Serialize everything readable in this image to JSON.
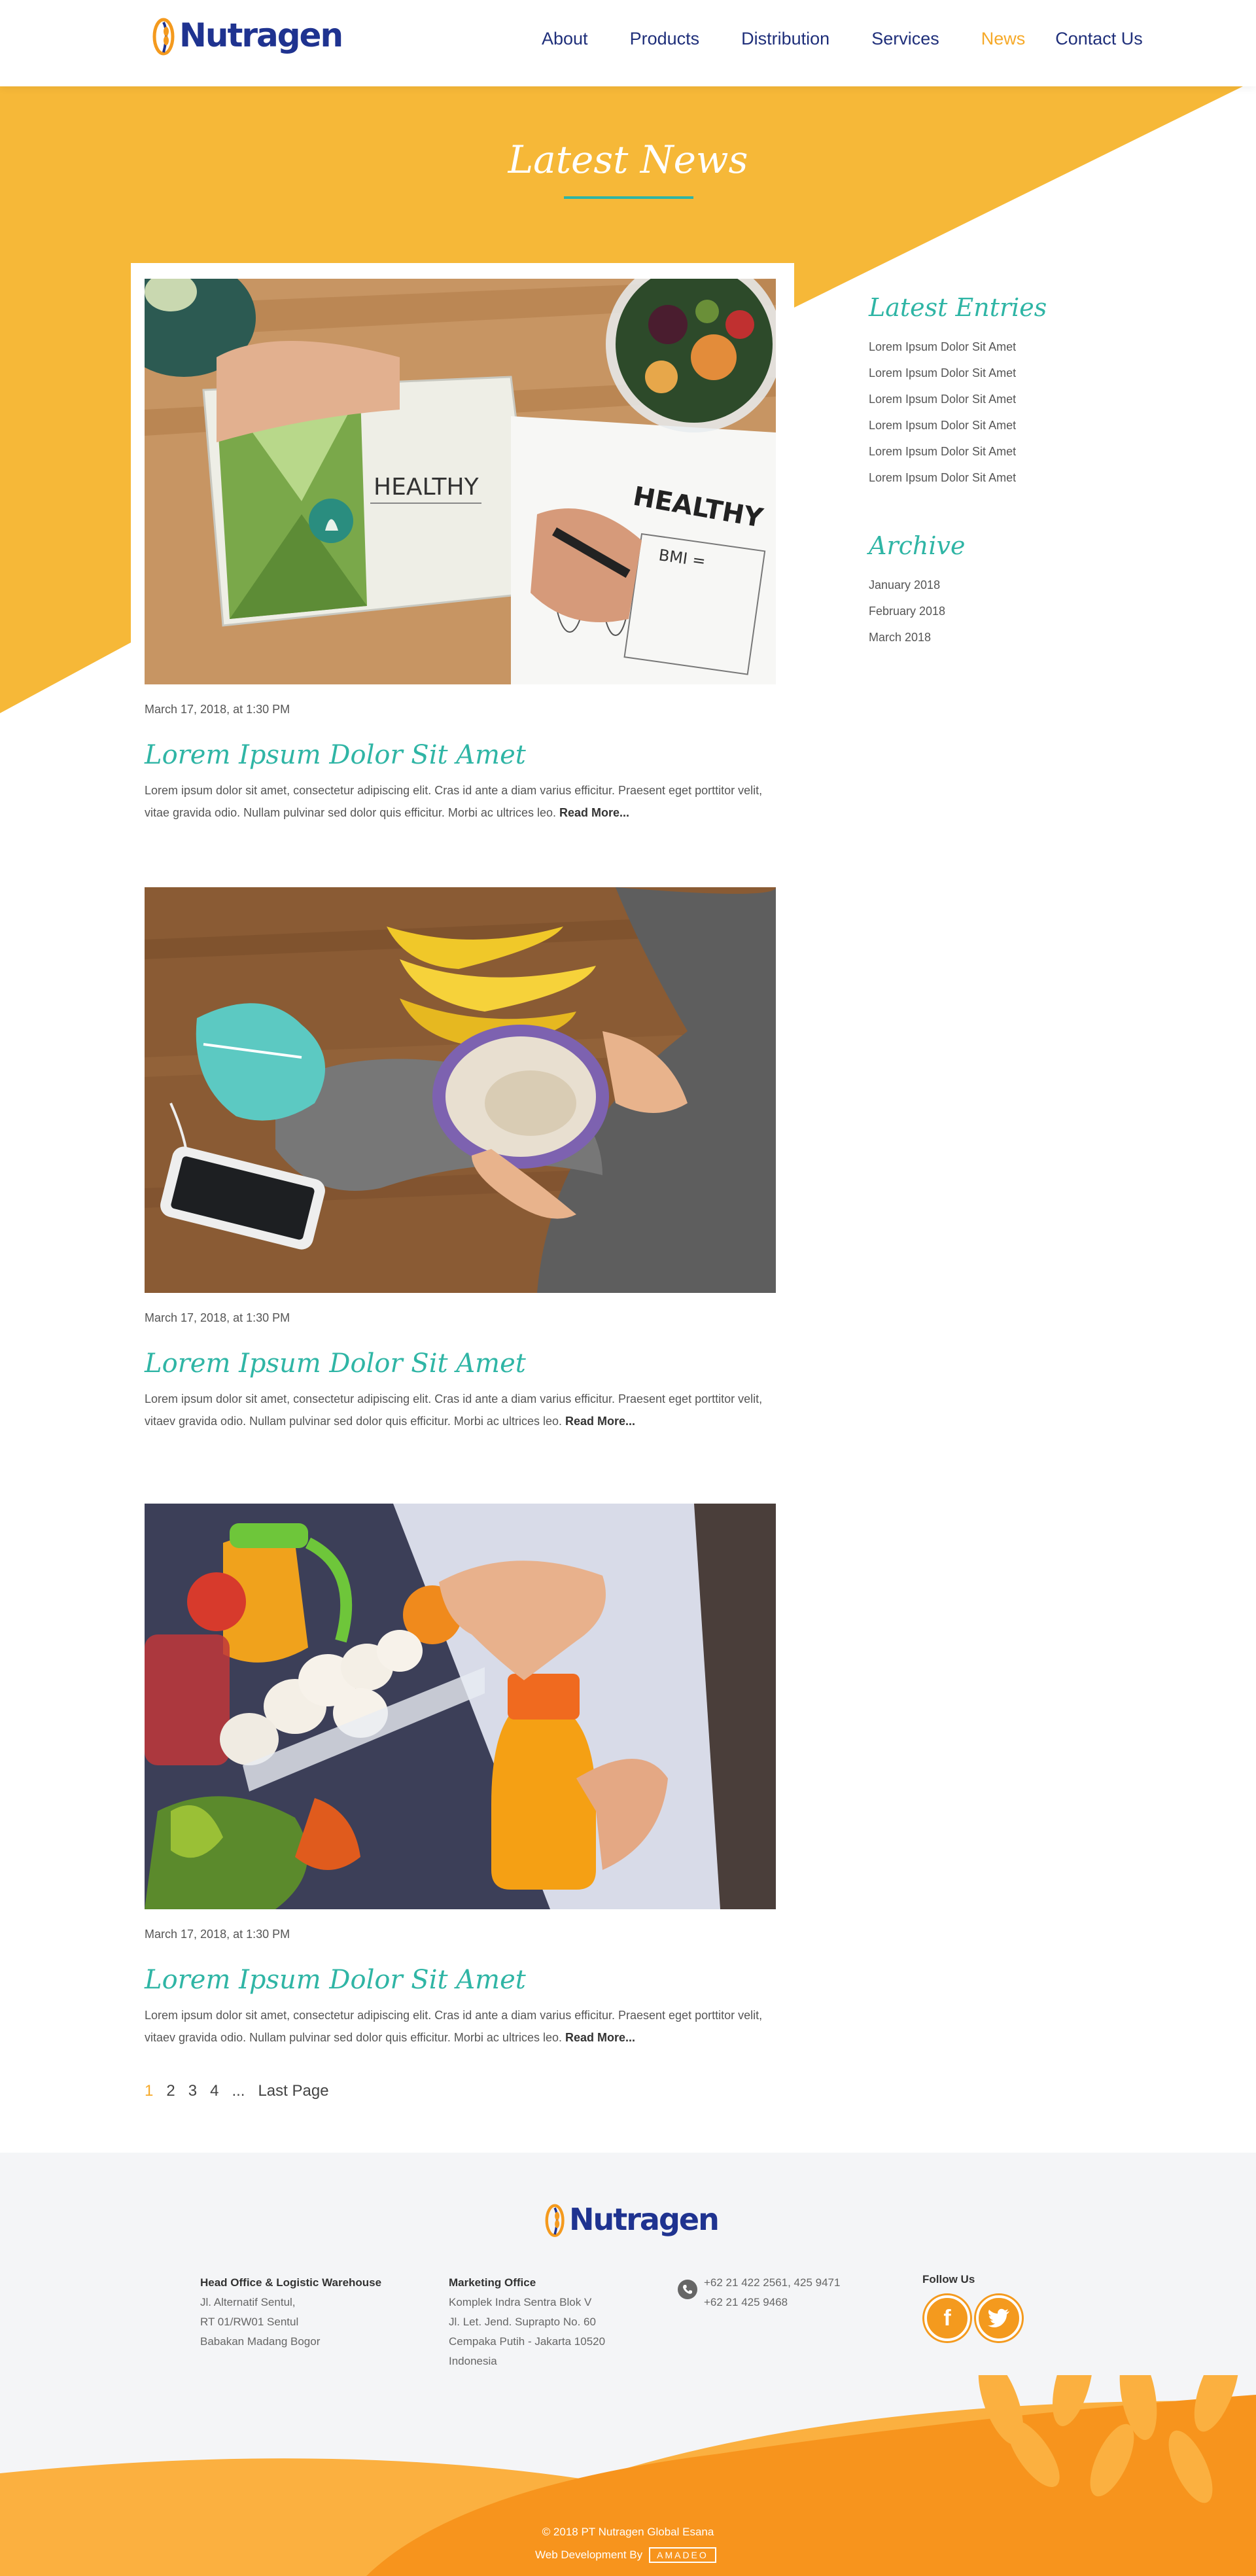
{
  "brand": {
    "name": "Nutragen"
  },
  "nav": [
    {
      "label": "About",
      "active": false
    },
    {
      "label": "Products",
      "active": false
    },
    {
      "label": "Distribution",
      "active": false
    },
    {
      "label": "Services",
      "active": false
    },
    {
      "label": "News",
      "active": true
    },
    {
      "label": "Contact Us",
      "active": false
    }
  ],
  "page": {
    "title": "Latest News"
  },
  "articles": [
    {
      "date": "March 17, 2018, at 1:30 PM",
      "title": "Lorem Ipsum Dolor Sit Amet",
      "excerpt": "Lorem ipsum dolor sit amet, consectetur adipiscing elit. Cras id ante a diam varius efficitur. Praesent eget porttitor velit, vitae gravida odio. Nullam pulvinar sed dolor quis efficitur. Morbi ac ultrices leo.",
      "read_more": "Read More...",
      "image": "healthy-notebook-photo",
      "image_text": "HEALTHY"
    },
    {
      "date": "March 17, 2018, at 1:30 PM",
      "title": "Lorem Ipsum Dolor Sit Amet",
      "excerpt": "Lorem ipsum dolor sit amet, consectetur adipiscing elit. Cras id ante a diam varius efficitur. Praesent eget porttitor velit, vitaev gravida odio. Nullam pulvinar sed dolor quis efficitur. Morbi ac ultrices leo.",
      "read_more": "Read More...",
      "image": "bananas-oatmeal-photo"
    },
    {
      "date": "March 17, 2018, at 1:30 PM",
      "title": "Lorem Ipsum Dolor Sit Amet",
      "excerpt": "Lorem ipsum dolor sit amet, consectetur adipiscing elit. Cras id ante a diam varius efficitur. Praesent eget porttitor velit, vitaev gravida odio. Nullam pulvinar sed dolor quis efficitur. Morbi ac ultrices leo.",
      "read_more": "Read More...",
      "image": "fridge-juice-photo"
    }
  ],
  "sidebar": {
    "latest_title": "Latest Entries",
    "latest": [
      "Lorem Ipsum Dolor Sit Amet",
      "Lorem Ipsum Dolor Sit Amet",
      "Lorem Ipsum Dolor Sit Amet",
      "Lorem Ipsum Dolor Sit Amet",
      "Lorem Ipsum Dolor Sit Amet",
      "Lorem Ipsum Dolor Sit Amet"
    ],
    "archive_title": "Archive",
    "archive": [
      "January 2018",
      "February 2018",
      "March 2018"
    ]
  },
  "pagination": {
    "pages": [
      "1",
      "2",
      "3",
      "4"
    ],
    "current": "1",
    "ellipsis": "...",
    "last": "Last Page"
  },
  "footer": {
    "head_office": {
      "title": "Head Office & Logistic Warehouse",
      "lines": [
        "Jl. Alternatif Sentul,",
        "RT 01/RW01 Sentul",
        "Babakan Madang Bogor"
      ]
    },
    "marketing_office": {
      "title": "Marketing Office",
      "lines": [
        "Komplek Indra Sentra Blok V",
        "Jl. Let. Jend. Suprapto No. 60",
        "Cempaka Putih - Jakarta 10520",
        "Indonesia"
      ]
    },
    "phones": [
      "+62 21 422 2561, 425 9471",
      "+62 21 425 9468"
    ],
    "follow_label": "Follow Us",
    "social": [
      {
        "name": "facebook-icon",
        "glyph": "f"
      },
      {
        "name": "twitter-icon",
        "glyph": "t"
      }
    ],
    "copyright": "2018 PT Nutragen Global Esana",
    "copyright_symbol": "©",
    "dev_by": "Web Development By",
    "dev_brand": "AMADEO"
  },
  "colors": {
    "accent_yellow": "#f6b838",
    "teal": "#2fb5a5",
    "navy": "#1f3390",
    "orange": "#f49a1e"
  }
}
